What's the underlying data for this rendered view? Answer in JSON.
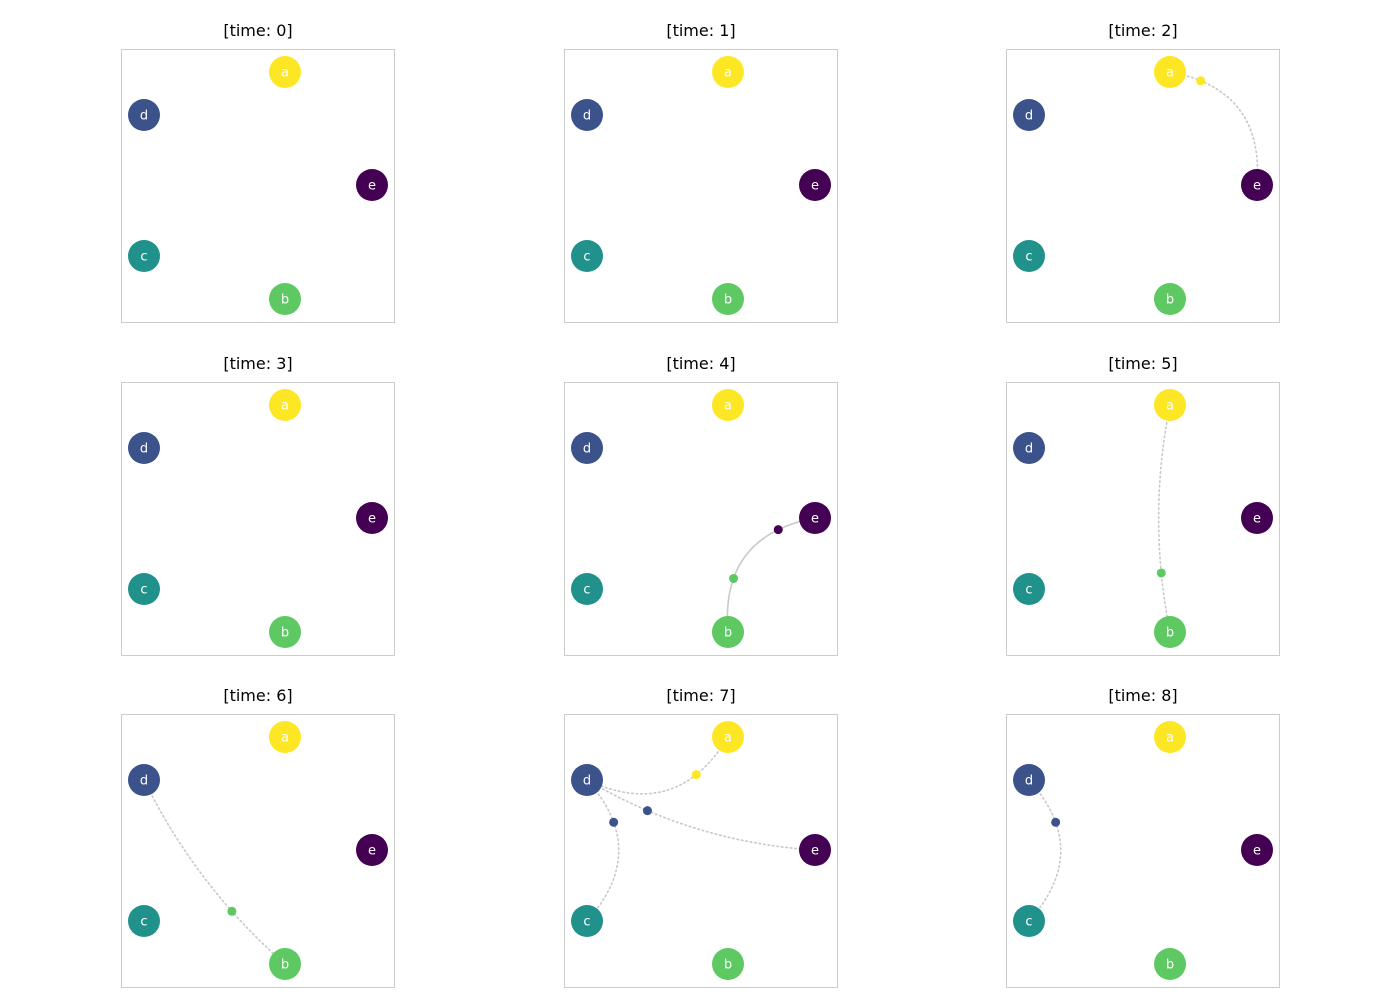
{
  "nodes": [
    {
      "id": "a",
      "label": "a",
      "color": "#fde725"
    },
    {
      "id": "b",
      "label": "b",
      "color": "#5ec962"
    },
    {
      "id": "c",
      "label": "c",
      "color": "#21918c"
    },
    {
      "id": "d",
      "label": "d",
      "color": "#3b528b"
    },
    {
      "id": "e",
      "label": "e",
      "color": "#440154"
    }
  ],
  "edge_style": {
    "color": "#c8c8c8",
    "dash": "dotted"
  },
  "panels": [
    {
      "title": "[time: 0]",
      "messages": []
    },
    {
      "title": "[time: 1]",
      "messages": []
    },
    {
      "title": "[time: 2]",
      "messages": [
        {
          "from": "a",
          "to": "e",
          "bend": -0.45,
          "dot_color": "#fde725",
          "dot_t": 0.18
        }
      ]
    },
    {
      "title": "[time: 3]",
      "messages": []
    },
    {
      "title": "[time: 4]",
      "messages": [
        {
          "from": "b",
          "to": "e",
          "bend": -0.45,
          "dot_color": "#5ec962",
          "dot_t": 0.32
        },
        {
          "from": "e",
          "to": "b",
          "bend": 0.45,
          "dot_color": "#440154",
          "dot_t": 0.22
        }
      ]
    },
    {
      "title": "[time: 5]",
      "messages": [
        {
          "from": "a",
          "to": "b",
          "bend": 0.1,
          "dot_color": "#5ec962",
          "dot_t": 0.74
        }
      ]
    },
    {
      "title": "[time: 6]",
      "messages": [
        {
          "from": "d",
          "to": "b",
          "bend": 0.1,
          "dot_color": "#5ec962",
          "dot_t": 0.68
        }
      ]
    },
    {
      "title": "[time: 7]",
      "messages": [
        {
          "from": "a",
          "to": "d",
          "bend": -0.45,
          "dot_color": "#fde725",
          "dot_t": 0.28
        },
        {
          "from": "d",
          "to": "c",
          "bend": -0.45,
          "dot_color": "#3b528b",
          "dot_t": 0.3
        },
        {
          "from": "d",
          "to": "e",
          "bend": 0.12,
          "dot_color": "#3b528b",
          "dot_t": 0.28
        }
      ]
    },
    {
      "title": "[time: 8]",
      "messages": [
        {
          "from": "d",
          "to": "c",
          "bend": -0.45,
          "dot_color": "#3b528b",
          "dot_t": 0.3
        }
      ]
    }
  ]
}
